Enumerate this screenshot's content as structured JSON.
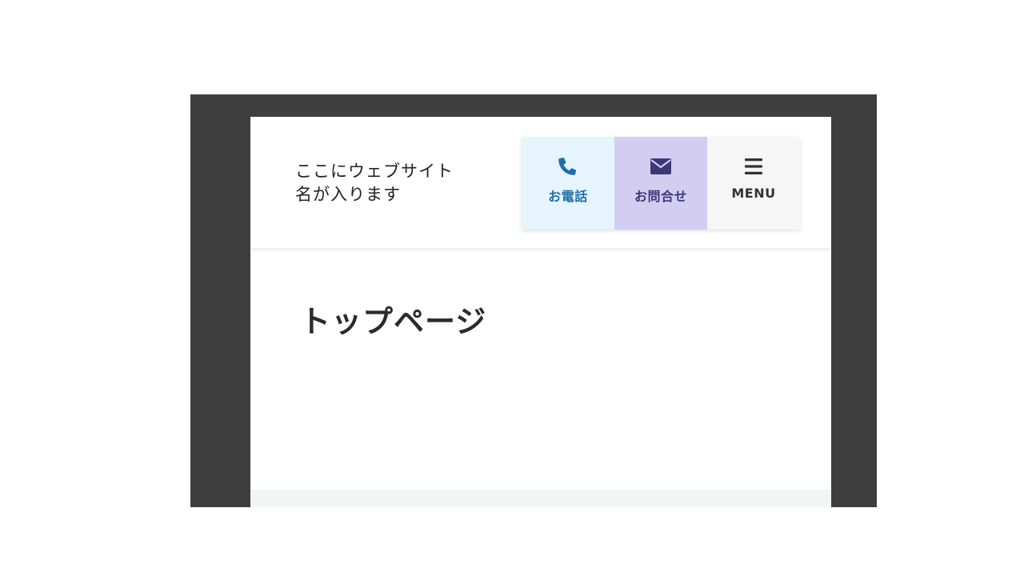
{
  "header": {
    "site_name_line1": "ここにウェブサイト",
    "site_name_line2": "名が入ります",
    "actions": {
      "tel": {
        "label": "お電話",
        "icon": "phone-icon",
        "bg": "#e6f4fd",
        "color": "#1e6fa8"
      },
      "mail": {
        "label": "お問合せ",
        "icon": "envelope-icon",
        "bg": "#d4cdf2",
        "color": "#3c3878"
      },
      "menu": {
        "label": "MENU",
        "icon": "hamburger-icon",
        "bg": "#f6f6f6",
        "color": "#333333"
      }
    }
  },
  "main": {
    "title": "トップページ"
  },
  "colors": {
    "frame": "#3e3e3e",
    "page_bg": "#ffffff",
    "footer_bg": "#f3f4f6"
  }
}
